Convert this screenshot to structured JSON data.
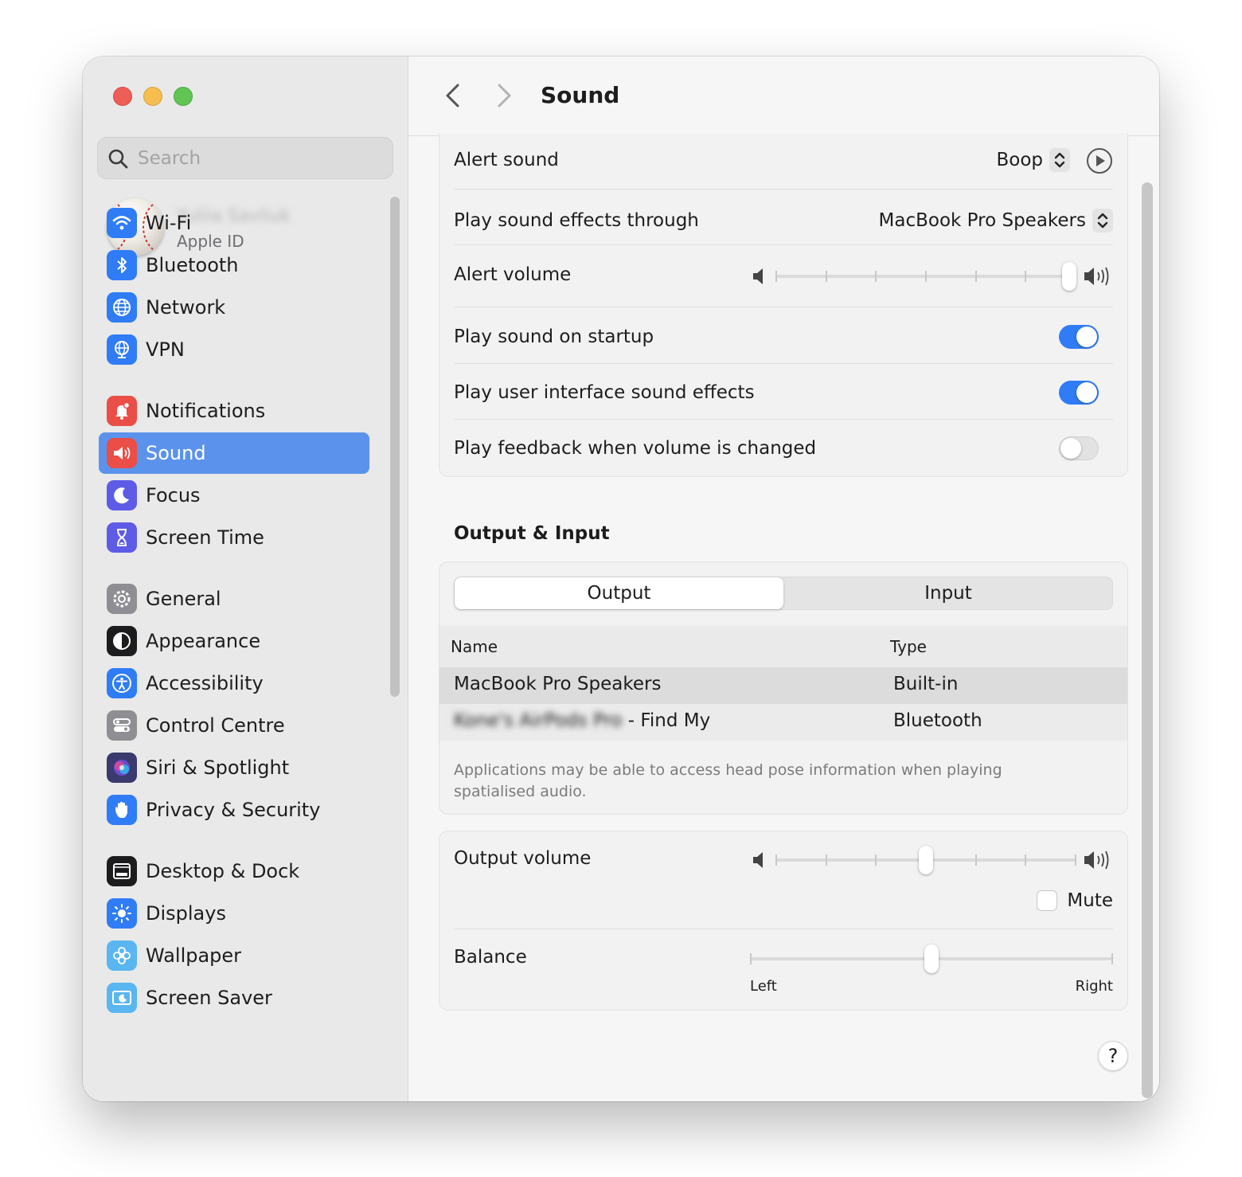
{
  "sidebar": {
    "search_placeholder": "Search",
    "account": {
      "name": "Yuliia Savliuk",
      "sub": "Apple ID"
    },
    "items": [
      {
        "label": "Wi-Fi",
        "icon": "wifi-icon",
        "color": "#2f7cf6"
      },
      {
        "label": "Bluetooth",
        "icon": "bluetooth-icon",
        "color": "#2f7cf6"
      },
      {
        "label": "Network",
        "icon": "globe-icon",
        "color": "#2f7cf6"
      },
      {
        "label": "VPN",
        "icon": "vpn-globe-icon",
        "color": "#2f7cf6"
      },
      {
        "label": "Notifications",
        "icon": "bell-icon",
        "color": "#eb4d47"
      },
      {
        "label": "Sound",
        "icon": "speaker-icon",
        "color": "#eb4d47"
      },
      {
        "label": "Focus",
        "icon": "moon-icon",
        "color": "#5e5ce6"
      },
      {
        "label": "Screen Time",
        "icon": "hourglass-icon",
        "color": "#5e5ce6"
      },
      {
        "label": "General",
        "icon": "gear-icon",
        "color": "#8e8e93"
      },
      {
        "label": "Appearance",
        "icon": "appearance-icon",
        "color": "#1c1c1e"
      },
      {
        "label": "Accessibility",
        "icon": "accessibility-icon",
        "color": "#2f7cf6"
      },
      {
        "label": "Control Centre",
        "icon": "control-centre-icon",
        "color": "#8e8e93"
      },
      {
        "label": "Siri & Spotlight",
        "icon": "siri-icon",
        "color": "#3a3a6e"
      },
      {
        "label": "Privacy & Security",
        "icon": "hand-icon",
        "color": "#2f7cf6"
      },
      {
        "label": "Desktop & Dock",
        "icon": "dock-icon",
        "color": "#1c1c1e"
      },
      {
        "label": "Displays",
        "icon": "sun-icon",
        "color": "#2f7cf6"
      },
      {
        "label": "Wallpaper",
        "icon": "flower-icon",
        "color": "#5ab6f0"
      },
      {
        "label": "Screen Saver",
        "icon": "screen-saver-icon",
        "color": "#5ab6f0"
      }
    ],
    "selected": "Sound"
  },
  "toolbar": {
    "title": "Sound"
  },
  "effects": {
    "alert_sound_label": "Alert sound",
    "alert_sound_value": "Boop",
    "sound_through_label": "Play sound effects through",
    "sound_through_value": "MacBook Pro Speakers",
    "alert_volume_label": "Alert volume",
    "alert_volume_level": 1.0,
    "startup_label": "Play sound on startup",
    "startup_on": true,
    "ui_effects_label": "Play user interface sound effects",
    "ui_effects_on": true,
    "feedback_label": "Play feedback when volume is changed",
    "feedback_on": false
  },
  "output_input": {
    "title": "Output & Input",
    "tabs": [
      "Output",
      "Input"
    ],
    "selected_tab": "Output",
    "columns": [
      "Name",
      "Type"
    ],
    "devices": [
      {
        "name": "MacBook Pro Speakers",
        "type": "Built-in",
        "name_prefix": ""
      },
      {
        "name": " - Find My",
        "type": "Bluetooth",
        "name_prefix": "Kone's AirPods Pro"
      }
    ],
    "note": "Applications may be able to access head pose information when playing spatialised audio."
  },
  "volume": {
    "output_label": "Output volume",
    "output_level": 0.5,
    "mute_label": "Mute",
    "muted": false,
    "balance_label": "Balance",
    "balance_level": 0.5,
    "left_label": "Left",
    "right_label": "Right"
  },
  "help_label": "?"
}
